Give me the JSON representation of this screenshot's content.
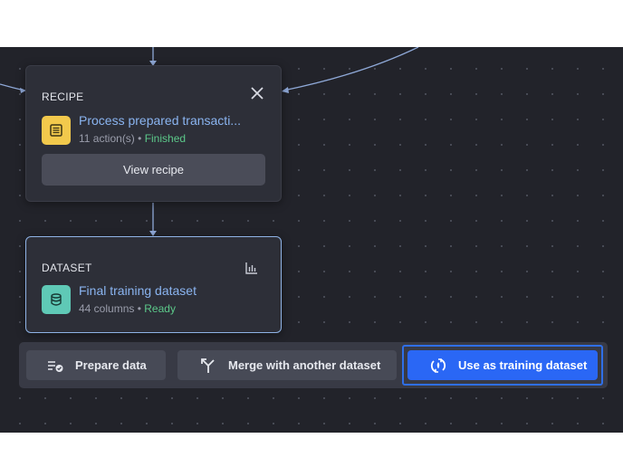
{
  "recipe_card": {
    "type_label": "RECIPE",
    "title": "Process prepared transacti...",
    "actions": "11 action(s)",
    "separator": " • ",
    "status": "Finished",
    "view_button": "View recipe",
    "icon": "list-icon",
    "icon_color": "#f2c94c"
  },
  "dataset_card": {
    "type_label": "DATASET",
    "title": "Final training dataset",
    "columns": "44 columns",
    "separator": " • ",
    "status": "Ready",
    "icon": "database-icon",
    "icon_color": "#5fc9b6"
  },
  "toolbar": {
    "prepare_label": "Prepare data",
    "merge_label": "Merge with another dataset",
    "training_label": "Use as training dataset"
  },
  "colors": {
    "accent": "#2a67f5",
    "status_ok": "#5cc98a",
    "link": "#8ab4f0"
  }
}
